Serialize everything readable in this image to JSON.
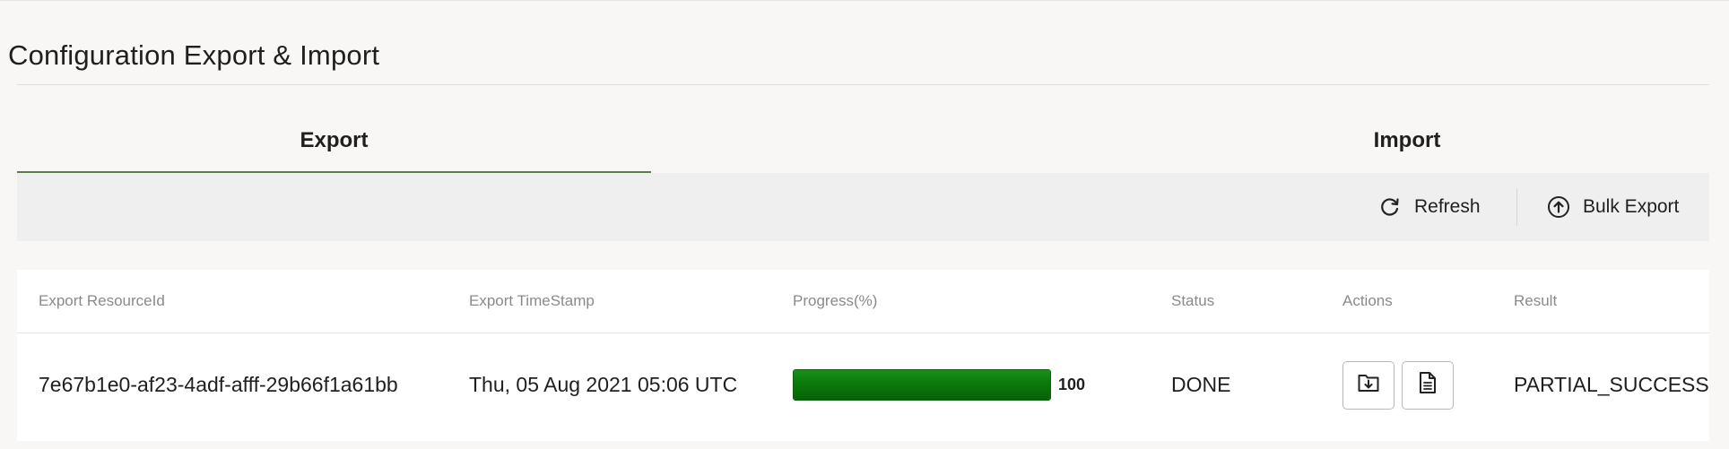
{
  "page": {
    "title": "Configuration Export & Import"
  },
  "tabs": [
    {
      "label": "Export",
      "active": true
    },
    {
      "label": "Import",
      "active": false
    }
  ],
  "toolbar": {
    "refresh_label": "Refresh",
    "refresh_icon": "refresh-icon",
    "bulk_export_label": "Bulk Export",
    "bulk_export_icon": "upload-circle-icon"
  },
  "table": {
    "columns": [
      "Export ResourceId",
      "Export TimeStamp",
      "Progress(%)",
      "Status",
      "Actions",
      "Result"
    ],
    "rows": [
      {
        "resource_id": "7e67b1e0-af23-4adf-afff-29b66f1a61bb",
        "timestamp": "Thu, 05 Aug 2021 05:06 UTC",
        "progress": 100,
        "progress_label": "100",
        "status": "DONE",
        "actions": [
          "download-file-icon",
          "document-icon"
        ],
        "result": "PARTIAL_SUCCESS"
      }
    ]
  },
  "colors": {
    "accent_tab": "#5b7a4e",
    "progress_fill": "#0a7a0a",
    "background": "#f8f7f5"
  }
}
